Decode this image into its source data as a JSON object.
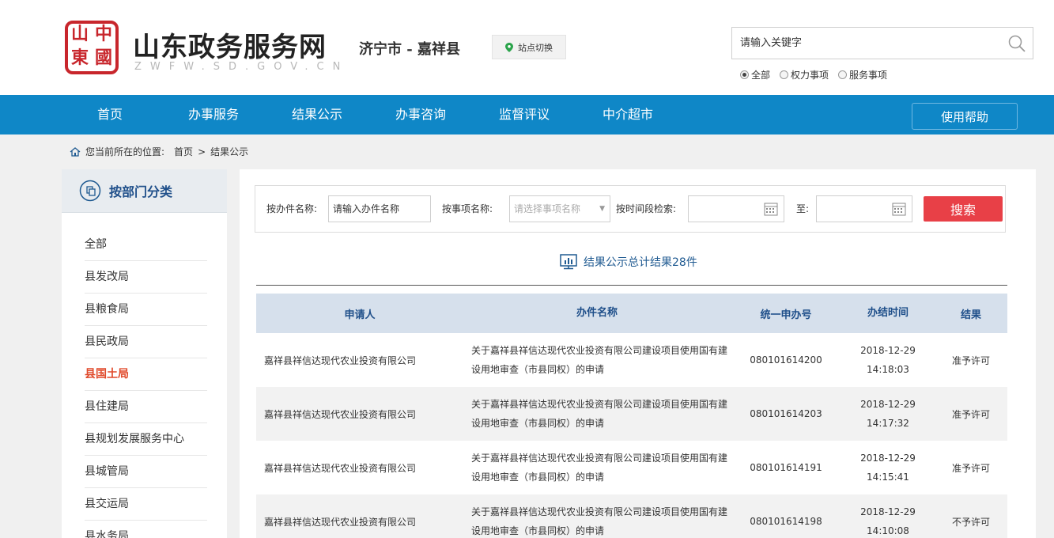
{
  "header": {
    "seal_glyphs": [
      "中",
      "國",
      "山",
      "東"
    ],
    "site_name": "山东政务服务网",
    "site_domain": "ZWFW.SD.GOV.CN",
    "city": "济宁市 - 嘉祥县",
    "switch_label": "站点切换",
    "search_placeholder": "请输入关键字",
    "radios": [
      "全部",
      "权力事项",
      "服务事项"
    ]
  },
  "nav": {
    "items": [
      "首页",
      "办事服务",
      "结果公示",
      "办事咨询",
      "监督评议",
      "中介超市"
    ],
    "help": "使用帮助"
  },
  "breadcrumb": {
    "prefix": "您当前所在的位置:",
    "home": "首页",
    "sep": ">",
    "current": "结果公示"
  },
  "sidebar": {
    "title": "按部门分类",
    "items": [
      "全部",
      "县发改局",
      "县粮食局",
      "县民政局",
      "县国土局",
      "县住建局",
      "县规划发展服务中心",
      "县城管局",
      "县交运局",
      "县水务局"
    ],
    "active_index": 4
  },
  "filter": {
    "name_label": "按办件名称:",
    "name_value": "请输入办件名称",
    "item_label": "按事项名称:",
    "item_placeholder": "请选择事项名称",
    "time_label": "按时间段检索:",
    "to_label": "至:",
    "search_button": "搜索"
  },
  "summary": "结果公示总计结果28件",
  "table": {
    "headers": [
      "申请人",
      "办件名称",
      "统一申办号",
      "办结时间",
      "结果"
    ],
    "rows": [
      {
        "applicant": "嘉祥县祥信达现代农业投资有限公司",
        "name": "关于嘉祥县祥信达现代农业投资有限公司建设项目使用国有建设用地审查（市县同权）的申请",
        "code": "080101614200",
        "date": "2018-12-29",
        "time": "14:18:03",
        "result": "准予许可"
      },
      {
        "applicant": "嘉祥县祥信达现代农业投资有限公司",
        "name": "关于嘉祥县祥信达现代农业投资有限公司建设项目使用国有建设用地审查（市县同权）的申请",
        "code": "080101614203",
        "date": "2018-12-29",
        "time": "14:17:32",
        "result": "准予许可"
      },
      {
        "applicant": "嘉祥县祥信达现代农业投资有限公司",
        "name": "关于嘉祥县祥信达现代农业投资有限公司建设项目使用国有建设用地审查（市县同权）的申请",
        "code": "080101614191",
        "date": "2018-12-29",
        "time": "14:15:41",
        "result": "准予许可"
      },
      {
        "applicant": "嘉祥县祥信达现代农业投资有限公司",
        "name": "关于嘉祥县祥信达现代农业投资有限公司建设项目使用国有建设用地审查（市县同权）的申请",
        "code": "080101614198",
        "date": "2018-12-29",
        "time": "14:10:08",
        "result": "不予许可"
      }
    ]
  },
  "colors": {
    "nav_bg": "#0f87c7",
    "seal_red": "#c8262c",
    "search_button": "#e84047",
    "active_sidebar": "#e04a2b",
    "table_header_bg": "#d6e0ec"
  }
}
